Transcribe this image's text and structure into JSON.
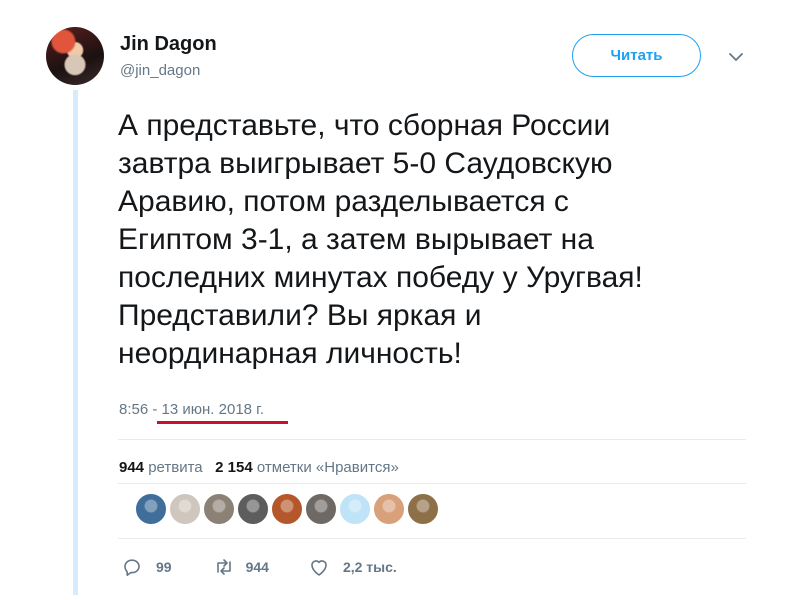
{
  "user": {
    "name": "Jin Dagon",
    "handle": "@jin_dagon"
  },
  "follow_button_label": "Читать",
  "tweet": {
    "text": "А представьте, что сборная России\nзавтра выигрывает 5-0 Саудовскую\nАравию, потом разделывается с\nЕгиптом 3-1, а затем вырывает на\nпоследних минутах победу у Уругвая!\nПредставили? Вы яркая и\nнеординарная личность!",
    "time": "8:56",
    "separator": " - ",
    "date": "13 июн. 2018 г."
  },
  "stats": {
    "retweets_count": "944",
    "retweets_label": "ретвита",
    "likes_count": "2 154",
    "likes_label": "отметки «Нравится»"
  },
  "likers": [
    {
      "icon": "liker-avatar-1",
      "color": "#3f6e9a"
    },
    {
      "icon": "liker-avatar-2",
      "color": "#cfc6bd"
    },
    {
      "icon": "liker-avatar-3",
      "color": "#8c8175"
    },
    {
      "icon": "liker-avatar-4",
      "color": "#5d5d5d"
    },
    {
      "icon": "liker-avatar-5",
      "color": "#b4572a"
    },
    {
      "icon": "liker-avatar-6",
      "color": "#6f6966"
    },
    {
      "icon": "liker-avatar-7",
      "color": "#bfe3f7"
    },
    {
      "icon": "liker-avatar-8",
      "color": "#d8a07b"
    },
    {
      "icon": "liker-avatar-9",
      "color": "#8d7048"
    }
  ],
  "actions": {
    "reply_count": "99",
    "retweet_count": "944",
    "like_count": "2,2 тыс."
  },
  "colors": {
    "accent": "#1da1f2",
    "underline": "#c8102e",
    "thread_line": "#d6ecfb"
  }
}
